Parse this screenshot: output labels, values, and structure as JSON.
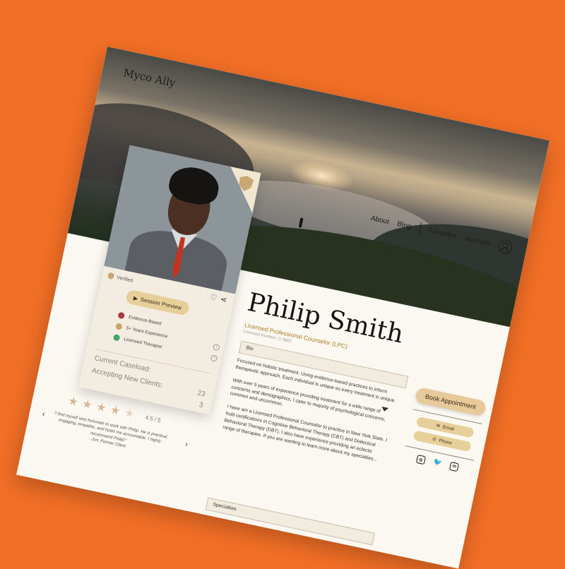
{
  "brand": {
    "logo": "Myco Ally"
  },
  "nav": {
    "about": "About",
    "blog": "Blog",
    "favorites": "Favorites",
    "account": "Account"
  },
  "profile": {
    "verified": "Verified",
    "session_preview": "Session Preview",
    "credentials": [
      {
        "label": "Evidence-Based",
        "color": "#a8393d"
      },
      {
        "label": "5+ Years Experience",
        "color": "#c8a46a"
      },
      {
        "label": "Licensed Therapist",
        "color": "#3fa66a"
      }
    ],
    "current_caseload_label": "Current Caseload:",
    "current_caseload_value": "23",
    "accepting_label": "Accepting New Clients:",
    "accepting_value": "3"
  },
  "reviews": {
    "rating": "4.5 / 5",
    "stars": 4.5,
    "quote": "\"I find myself very fortunate to work with Philip. He is practical, engaging, empathic, and holds me accountable. I highly recommend Philip!\"",
    "author": "- Jon, Former Client"
  },
  "therapist": {
    "name": "Philip Smith",
    "title": "Licensed Professional Counselor (LPC)",
    "license": "Licensed Number: C-3667"
  },
  "bio": {
    "label": "Bio",
    "p1": "Focused on holistic treatment. Using evidence-based practices to inform therapeutic approach. Each individual is unique so every treatment is unique.",
    "p2": "With over 5 years of experience providing treatment for a wide range of concerns and demographics, I cater to majority of psychological concerns, common and uncommon.",
    "p3": "I have am a Licensed Professional Counselor to practice in New York State. I hold certifications in Cognitive Behavioral Therapy (CBT) and Dialectical Behavioral Therapy (DBT). I also have experience providing an eclectic range of therapies. If you are wanting to learn more about my specialties..."
  },
  "specialties": {
    "label": "Specialties"
  },
  "actions": {
    "book": "Book Appointment",
    "email": "Email",
    "phone": "Phone"
  }
}
